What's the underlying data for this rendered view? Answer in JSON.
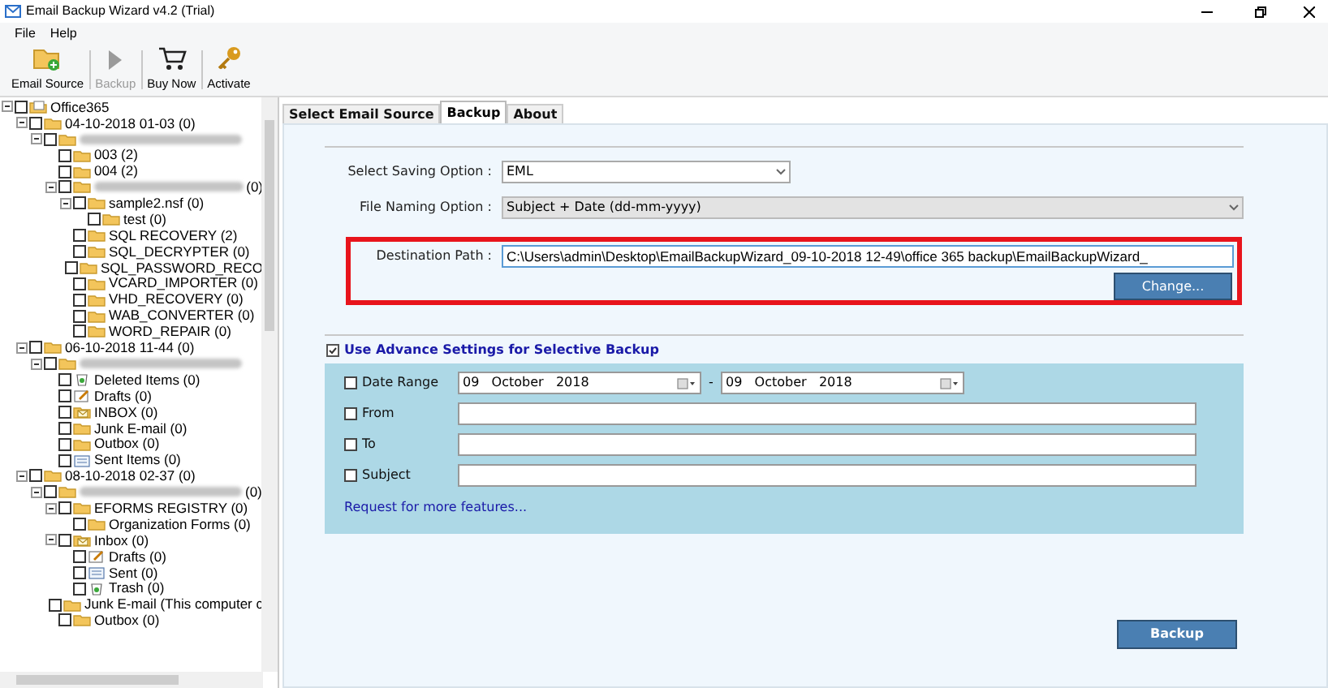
{
  "window": {
    "title": "Email Backup Wizard v4.2 (Trial)"
  },
  "menu": [
    {
      "label": "File"
    },
    {
      "label": "Help"
    }
  ],
  "toolbar": [
    {
      "label": "Email Source",
      "kind": "folder-add",
      "disabled": false
    },
    {
      "label": "Backup",
      "kind": "play",
      "disabled": true
    },
    {
      "label": "Buy Now",
      "kind": "cart",
      "disabled": false
    },
    {
      "label": "Activate",
      "kind": "key",
      "disabled": false
    }
  ],
  "tree": [
    {
      "label": "Office365",
      "kind": "drive",
      "checked": false,
      "expanded": true,
      "children": [
        {
          "label": "04-10-2018 01-03 (0)",
          "kind": "folder",
          "checked": false,
          "expanded": true,
          "children": [
            {
              "blurred": true,
              "kind": "folder",
              "checked": false,
              "expanded": true,
              "children": [
                {
                  "label": "003 (2)",
                  "kind": "folder",
                  "checked": false
                },
                {
                  "label": "004 (2)",
                  "kind": "folder",
                  "checked": false
                },
                {
                  "blurred": true,
                  "label": "(0)",
                  "kind": "folder",
                  "checked": false,
                  "expanded": true,
                  "children": [
                    {
                      "label": "sample2.nsf (0)",
                      "kind": "folder",
                      "checked": false,
                      "expanded": true,
                      "children": [
                        {
                          "label": "test (0)",
                          "kind": "folder",
                          "checked": false
                        }
                      ]
                    },
                    {
                      "label": "SQL RECOVERY (2)",
                      "kind": "folder",
                      "checked": false
                    },
                    {
                      "label": "SQL_DECRYPTER (0)",
                      "kind": "folder",
                      "checked": false
                    },
                    {
                      "label": "SQL_PASSWORD_RECO",
                      "kind": "folder",
                      "checked": false
                    },
                    {
                      "label": "VCARD_IMPORTER (0)",
                      "kind": "folder",
                      "checked": false
                    },
                    {
                      "label": "VHD_RECOVERY (0)",
                      "kind": "folder",
                      "checked": false
                    },
                    {
                      "label": "WAB_CONVERTER (0)",
                      "kind": "folder",
                      "checked": false
                    },
                    {
                      "label": "WORD_REPAIR (0)",
                      "kind": "folder",
                      "checked": false
                    }
                  ]
                }
              ]
            }
          ]
        },
        {
          "label": "06-10-2018 11-44 (0)",
          "kind": "folder",
          "checked": false,
          "expanded": true,
          "children": [
            {
              "blurred": true,
              "kind": "folder",
              "checked": false,
              "expanded": true,
              "children": [
                {
                  "label": "Deleted Items (0)",
                  "kind": "recycle",
                  "checked": false
                },
                {
                  "label": "Drafts (0)",
                  "kind": "drafts",
                  "checked": false
                },
                {
                  "label": "INBOX (0)",
                  "kind": "inbox",
                  "checked": false
                },
                {
                  "label": "Junk E-mail (0)",
                  "kind": "folder",
                  "checked": false
                },
                {
                  "label": "Outbox (0)",
                  "kind": "folder",
                  "checked": false
                },
                {
                  "label": "Sent Items (0)",
                  "kind": "sent",
                  "checked": false
                }
              ]
            }
          ]
        },
        {
          "label": "08-10-2018 02-37 (0)",
          "kind": "folder",
          "checked": false,
          "expanded": true,
          "children": [
            {
              "blurred": true,
              "label": "(0)",
              "kind": "folder",
              "checked": false,
              "expanded": true,
              "children": [
                {
                  "label": "EFORMS REGISTRY (0)",
                  "kind": "folder",
                  "checked": false,
                  "expanded": true,
                  "children": [
                    {
                      "label": "Organization Forms (0)",
                      "kind": "folder",
                      "checked": false
                    }
                  ]
                },
                {
                  "label": "Inbox (0)",
                  "kind": "inbox",
                  "checked": false,
                  "expanded": true,
                  "children": [
                    {
                      "label": "Drafts (0)",
                      "kind": "drafts",
                      "checked": false
                    },
                    {
                      "label": "Sent (0)",
                      "kind": "sent",
                      "checked": false
                    },
                    {
                      "label": "Trash (0)",
                      "kind": "recycle",
                      "checked": false
                    }
                  ]
                },
                {
                  "label": "Junk E-mail (This computer c",
                  "kind": "folder",
                  "checked": false
                },
                {
                  "label": "Outbox (0)",
                  "kind": "folder",
                  "checked": false
                }
              ]
            }
          ]
        }
      ]
    }
  ],
  "tabs": [
    {
      "label": "Select Email Source",
      "selected": false
    },
    {
      "label": "Backup",
      "selected": true
    },
    {
      "label": "About",
      "selected": false
    }
  ],
  "backup": {
    "saving_option": {
      "label": "Select Saving Option :",
      "value": "EML"
    },
    "naming_option": {
      "label": "File Naming Option :",
      "value": "Subject + Date (dd-mm-yyyy)",
      "disabled": true
    },
    "destination": {
      "label": "Destination Path :",
      "value": "C:\\Users\\admin\\Desktop\\EmailBackupWizard_09-10-2018 12-49\\office 365 backup\\EmailBackupWizard_",
      "highlighted": true
    },
    "change_button": "Change...",
    "advanced": {
      "label": "Use Advance Settings for Selective Backup",
      "checked": true,
      "filters": [
        {
          "kind": "date",
          "label": "Date Range",
          "checked": false,
          "from": "09   October   2018",
          "separator": "-",
          "to": "09   October   2018"
        },
        {
          "kind": "text",
          "label": "From",
          "checked": false
        },
        {
          "kind": "text",
          "label": "To",
          "checked": false
        },
        {
          "kind": "text",
          "label": "Subject",
          "checked": false
        }
      ],
      "link": "Request for more features..."
    },
    "backup_button": "Backup"
  }
}
